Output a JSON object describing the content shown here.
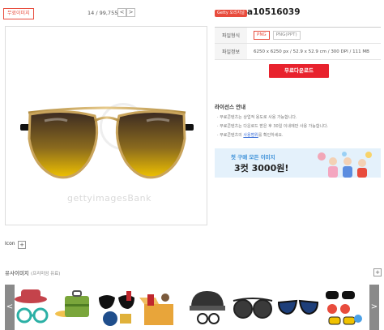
{
  "left": {
    "tag_button": "무료이미지",
    "counter": "14 / 99,755",
    "prev": "<",
    "next": ">",
    "watermark": "gettyimagesBank"
  },
  "right": {
    "badge": "Getty 오리지널",
    "code": "a10516039",
    "file_type_label": "파일형식",
    "formats": [
      "PNG",
      "PNG(PPT)"
    ],
    "file_info_label": "파일정보",
    "file_info": "6250 x 6250 px  /  52.9 x 52.9 cm  /  300 DPI  /  111 MB",
    "download": "무료다운로드",
    "license_title": "라이선스 안내",
    "license_lines": [
      "· 무료콘텐츠는 상업적 용도로 사용 가능합니다.",
      "· 무료콘텐츠는 다운로드 받은 후 30일 이내에만 사용 가능합니다.",
      "사용범위"
    ],
    "license_line3_prefix": "· 무료콘텐츠의",
    "license_line3_suffix": "를 확인하세요.",
    "banner_line1": "첫 구매 모든 이미지",
    "banner_line2": "3컷 3000원!"
  },
  "bottom": {
    "icon_label": "Icon",
    "similar_title": "유사이미지",
    "similar_sub": "(프리미엄 유료)",
    "plus": "+"
  },
  "colors": {
    "accent": "#e8222d",
    "border_red": "#e84c3d",
    "banner_bg": "#e4f1fb"
  }
}
